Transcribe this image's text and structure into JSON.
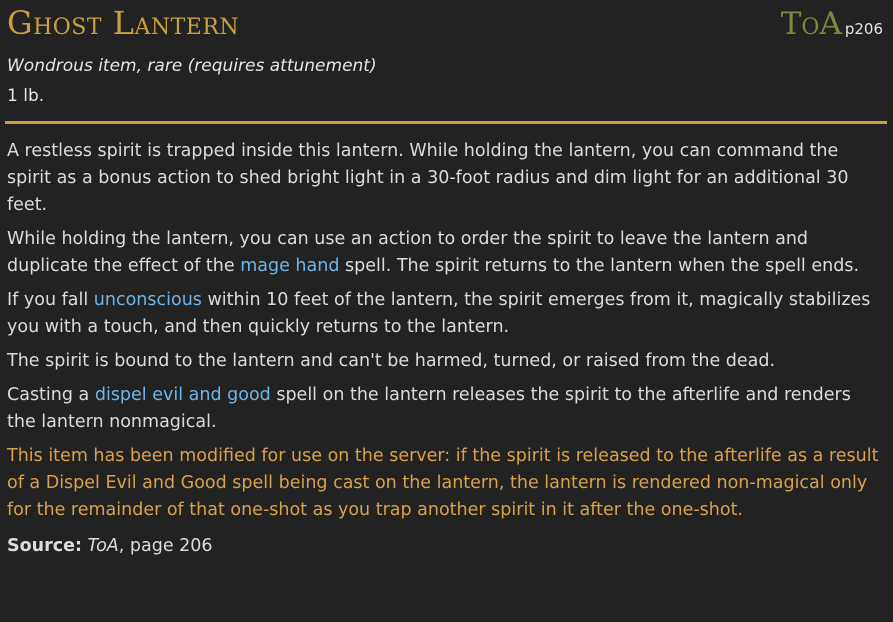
{
  "item": {
    "title": "Ghost Lantern",
    "source_abbr": "ToA",
    "source_page": "p206",
    "type": "Wondrous item, rare (requires attunement)",
    "weight": "1 lb."
  },
  "paragraphs": {
    "p1": "A restless spirit is trapped inside this lantern. While holding the lantern, you can command the spirit as a bonus action to shed bright light in a 30-foot radius and dim light for an additional 30 feet.",
    "p2_before": "While holding the lantern, you can use an action to order the spirit to leave the lantern and duplicate the effect of the ",
    "p2_link": "mage hand",
    "p2_after": " spell. The spirit returns to the lantern when the spell ends.",
    "p3_before": "If you fall ",
    "p3_link": "unconscious",
    "p3_after": " within 10 feet of the lantern, the spirit emerges from it, magically stabilizes you with a touch, and then quickly returns to the lantern.",
    "p4": "The spirit is bound to the lantern and can't be harmed, turned, or raised from the dead.",
    "p5_before": "Casting a ",
    "p5_link": "dispel evil and good",
    "p5_after": " spell on the lantern releases the spirit to the afterlife and renders the lantern nonmagical.",
    "note": "This item has been modified for use on the server: if the spirit is released to the afterlife as a result of a Dispel Evil and Good spell being cast on the lantern, the lantern is rendered non-magical only for the remainder of that one-shot as you trap another spirit in it after the one-shot."
  },
  "source": {
    "label": "Source:",
    "book": "ToA",
    "page": ", page 206"
  },
  "colors": {
    "background": "#222222",
    "title": "#c9a13b",
    "source_abbr": "#7b8a41",
    "link": "#6fb6e8",
    "note": "#d8a24a",
    "text": "#dcdcdc"
  }
}
